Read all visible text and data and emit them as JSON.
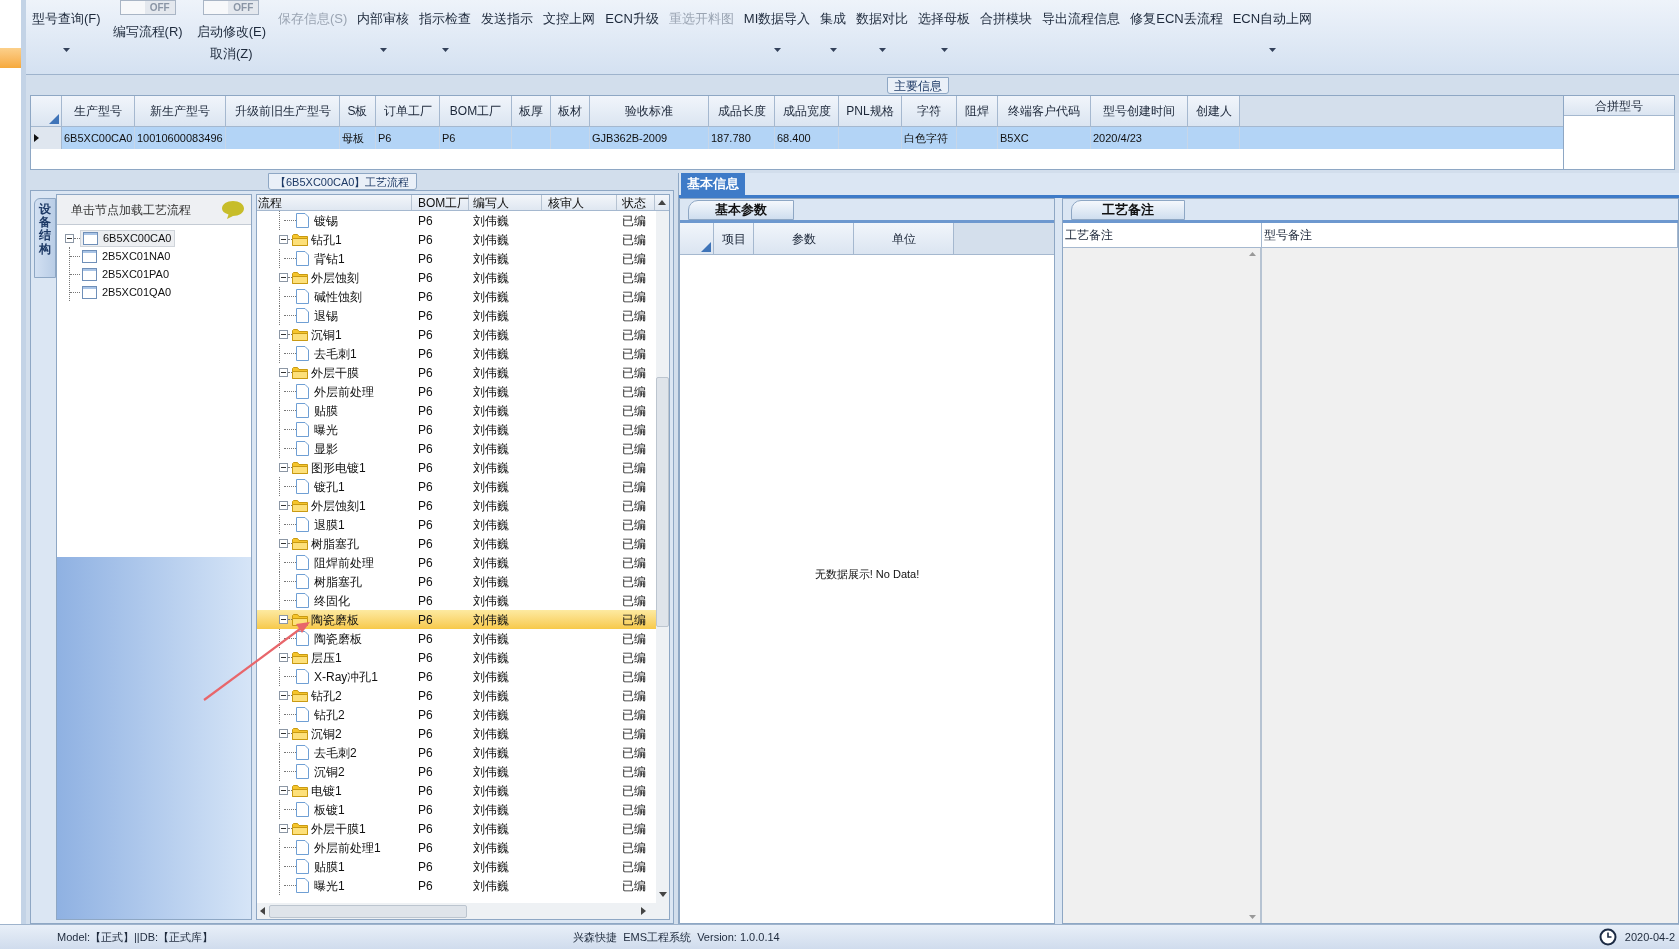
{
  "toolbar": [
    {
      "kind": "button",
      "label": "型号查询(F)",
      "dropdown": true,
      "disabled": false
    },
    {
      "kind": "toggle",
      "toggle_text": "OFF",
      "on": false,
      "label": "编写流程(R)"
    },
    {
      "kind": "toggle",
      "toggle_text": "OFF",
      "on": false,
      "label": "启动修改(E)",
      "second_label": "取消(Z)"
    },
    {
      "kind": "button",
      "label": "保存信息(S)",
      "dropdown": false,
      "disabled": true
    },
    {
      "kind": "button",
      "label": "内部审核",
      "dropdown": true,
      "disabled": false
    },
    {
      "kind": "button",
      "label": "指示检查",
      "dropdown": true,
      "disabled": false
    },
    {
      "kind": "button",
      "label": "发送指示",
      "dropdown": false,
      "disabled": false
    },
    {
      "kind": "button",
      "label": "文控上网",
      "dropdown": false,
      "disabled": false
    },
    {
      "kind": "button",
      "label": "ECN升级",
      "dropdown": false,
      "disabled": false
    },
    {
      "kind": "button",
      "label": "重选开料图",
      "dropdown": false,
      "disabled": true
    },
    {
      "kind": "button",
      "label": "MI数据导入",
      "dropdown": true,
      "disabled": false
    },
    {
      "kind": "button",
      "label": "集成",
      "dropdown": true,
      "disabled": false
    },
    {
      "kind": "button",
      "label": "数据对比",
      "dropdown": true,
      "disabled": false
    },
    {
      "kind": "button",
      "label": "选择母板",
      "dropdown": true,
      "disabled": false
    },
    {
      "kind": "button",
      "label": "合拼模块",
      "dropdown": false,
      "disabled": false
    },
    {
      "kind": "button",
      "label": "导出流程信息",
      "dropdown": false,
      "disabled": false
    },
    {
      "kind": "button",
      "label": "修复ECN丢流程",
      "dropdown": false,
      "disabled": false
    },
    {
      "kind": "button",
      "label": "ECN自动上网",
      "dropdown": true,
      "disabled": false
    }
  ],
  "main_info": {
    "title": "主要信息",
    "columns": [
      "生产型号",
      "新生产型号",
      "升级前旧生产型号",
      "S板",
      "订单工厂",
      "BOM工厂",
      "板厚",
      "板材",
      "验收标准",
      "成品长度",
      "成品宽度",
      "PNL规格",
      "字符",
      "阻焊",
      "终端客户代码",
      "型号创建时间",
      "创建人"
    ],
    "rows": [
      {
        "selected": true,
        "cells": [
          "6B5XC00CA0",
          "10010600083496",
          null,
          "母板",
          "P6",
          "P6",
          null,
          null,
          "GJB362B-2009",
          "187.780",
          "68.400",
          null,
          "白色字符",
          null,
          "B5XC",
          "2020/4/23",
          null
        ]
      }
    ],
    "side_column": "合拼型号"
  },
  "process_panel": {
    "title": "【6B5XC00CA0】工艺流程",
    "side_tab": "设备结构",
    "tree_header": "单击节点加载工艺流程",
    "device_tree": [
      {
        "label": "6B5XC00CA0",
        "selected": true,
        "expanded": true,
        "children": [
          {
            "label": "2B5XC01NA0",
            "selected": false
          },
          {
            "label": "2B5XC01PA0",
            "selected": false
          },
          {
            "label": "2B5XC01QA0",
            "selected": false
          }
        ]
      }
    ],
    "flow_columns": [
      "流程",
      "BOM工厂",
      "编写人",
      "核审人",
      "状态"
    ],
    "flow_rows": [
      {
        "children": [
          {
            "name": "镀锡",
            "bom": "P6",
            "author": "刘伟巍",
            "status": "已编",
            "selected": false
          }
        ]
      },
      {
        "name": "钻孔1",
        "bom": "P6",
        "author": "刘伟巍",
        "status": "已编",
        "selected": false,
        "expanded": true,
        "children": [
          {
            "name": "背钻1",
            "bom": "P6",
            "author": "刘伟巍",
            "status": "已编",
            "selected": false
          }
        ]
      },
      {
        "name": "外层蚀刻",
        "bom": "P6",
        "author": "刘伟巍",
        "status": "已编",
        "selected": false,
        "expanded": true,
        "children": [
          {
            "name": "碱性蚀刻",
            "bom": "P6",
            "author": "刘伟巍",
            "status": "已编",
            "selected": false
          },
          {
            "name": "退锡",
            "bom": "P6",
            "author": "刘伟巍",
            "status": "已编",
            "selected": false
          }
        ]
      },
      {
        "name": "沉铜1",
        "bom": "P6",
        "author": "刘伟巍",
        "status": "已编",
        "selected": false,
        "expanded": true,
        "children": [
          {
            "name": "去毛刺1",
            "bom": "P6",
            "author": "刘伟巍",
            "status": "已编",
            "selected": false
          }
        ]
      },
      {
        "name": "外层干膜",
        "bom": "P6",
        "author": "刘伟巍",
        "status": "已编",
        "selected": false,
        "expanded": true,
        "children": [
          {
            "name": "外层前处理",
            "bom": "P6",
            "author": "刘伟巍",
            "status": "已编",
            "selected": false
          },
          {
            "name": "贴膜",
            "bom": "P6",
            "author": "刘伟巍",
            "status": "已编",
            "selected": false
          },
          {
            "name": "曝光",
            "bom": "P6",
            "author": "刘伟巍",
            "status": "已编",
            "selected": false
          },
          {
            "name": "显影",
            "bom": "P6",
            "author": "刘伟巍",
            "status": "已编",
            "selected": false
          }
        ]
      },
      {
        "name": "图形电镀1",
        "bom": "P6",
        "author": "刘伟巍",
        "status": "已编",
        "selected": false,
        "expanded": true,
        "children": [
          {
            "name": "镀孔1",
            "bom": "P6",
            "author": "刘伟巍",
            "status": "已编",
            "selected": false
          }
        ]
      },
      {
        "name": "外层蚀刻1",
        "bom": "P6",
        "author": "刘伟巍",
        "status": "已编",
        "selected": false,
        "expanded": true,
        "children": [
          {
            "name": "退膜1",
            "bom": "P6",
            "author": "刘伟巍",
            "status": "已编",
            "selected": false
          }
        ]
      },
      {
        "name": "树脂塞孔",
        "bom": "P6",
        "author": "刘伟巍",
        "status": "已编",
        "selected": false,
        "expanded": true,
        "children": [
          {
            "name": "阻焊前处理",
            "bom": "P6",
            "author": "刘伟巍",
            "status": "已编",
            "selected": false
          },
          {
            "name": "树脂塞孔",
            "bom": "P6",
            "author": "刘伟巍",
            "status": "已编",
            "selected": false
          },
          {
            "name": "终固化",
            "bom": "P6",
            "author": "刘伟巍",
            "status": "已编",
            "selected": false
          }
        ]
      },
      {
        "name": "陶瓷磨板",
        "bom": "P6",
        "author": "刘伟巍",
        "status": "已编",
        "selected": true,
        "expanded": true,
        "children": [
          {
            "name": "陶瓷磨板",
            "bom": "P6",
            "author": "刘伟巍",
            "status": "已编",
            "selected": false
          }
        ]
      },
      {
        "name": "层压1",
        "bom": "P6",
        "author": "刘伟巍",
        "status": "已编",
        "selected": false,
        "expanded": true,
        "children": [
          {
            "name": "X-Ray冲孔1",
            "bom": "P6",
            "author": "刘伟巍",
            "status": "已编",
            "selected": false
          }
        ]
      },
      {
        "name": "钻孔2",
        "bom": "P6",
        "author": "刘伟巍",
        "status": "已编",
        "selected": false,
        "expanded": true,
        "children": [
          {
            "name": "钻孔2",
            "bom": "P6",
            "author": "刘伟巍",
            "status": "已编",
            "selected": false
          }
        ]
      },
      {
        "name": "沉铜2",
        "bom": "P6",
        "author": "刘伟巍",
        "status": "已编",
        "selected": false,
        "expanded": true,
        "children": [
          {
            "name": "去毛刺2",
            "bom": "P6",
            "author": "刘伟巍",
            "status": "已编",
            "selected": false
          },
          {
            "name": "沉铜2",
            "bom": "P6",
            "author": "刘伟巍",
            "status": "已编",
            "selected": false
          }
        ]
      },
      {
        "name": "电镀1",
        "bom": "P6",
        "author": "刘伟巍",
        "status": "已编",
        "selected": false,
        "expanded": true,
        "children": [
          {
            "name": "板镀1",
            "bom": "P6",
            "author": "刘伟巍",
            "status": "已编",
            "selected": false
          }
        ]
      },
      {
        "name": "外层干膜1",
        "bom": "P6",
        "author": "刘伟巍",
        "status": "已编",
        "selected": false,
        "expanded": true,
        "children": [
          {
            "name": "外层前处理1",
            "bom": "P6",
            "author": "刘伟巍",
            "status": "已编",
            "selected": false
          },
          {
            "name": "贴膜1",
            "bom": "P6",
            "author": "刘伟巍",
            "status": "已编",
            "selected": false
          },
          {
            "name": "曝光1",
            "bom": "P6",
            "author": "刘伟巍",
            "status": "已编",
            "selected": false
          }
        ]
      }
    ]
  },
  "detail_panel": {
    "tabs": [
      {
        "label": "基本信息",
        "selected": true
      }
    ],
    "params": {
      "tab": "基本参数",
      "columns": [
        "项目",
        "参数",
        "单位"
      ],
      "empty_text": "无数据展示! No Data!"
    },
    "notes": {
      "tab": "工艺备注",
      "columns": [
        "工艺备注",
        "型号备注"
      ]
    }
  },
  "status_bar": {
    "model": "Model:【正式】||DB:【正式库】",
    "app": "兴森快捷  EMS工程系统  Version: 1.0.0.14",
    "date": "2020-04-2"
  }
}
